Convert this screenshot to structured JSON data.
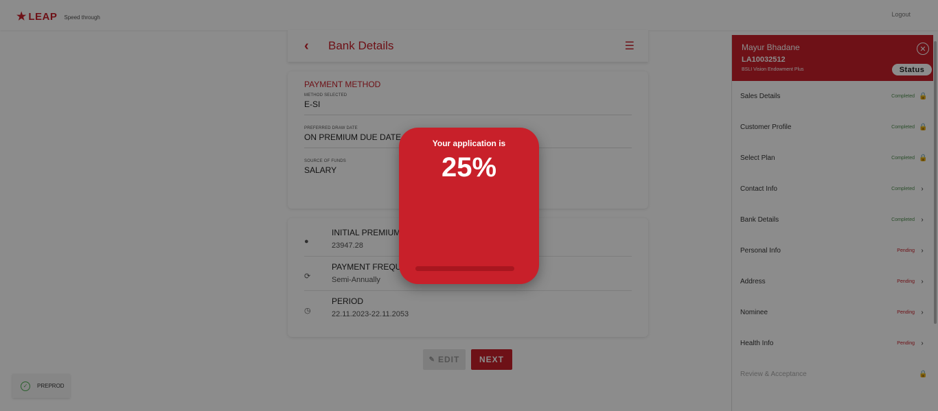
{
  "header": {
    "logo_text": "LEAP",
    "tagline": "Speed through",
    "logout": "Logout"
  },
  "page": {
    "title": "Bank Details"
  },
  "payment": {
    "section_title": "PAYMENT METHOD",
    "fields": [
      {
        "label": "METHOD SELECTED",
        "value": "E-SI"
      },
      {
        "label": "PREFERRED DRAW DATE",
        "value": "ON PREMIUM DUE DATE"
      },
      {
        "label": "SOURCE OF FUNDS",
        "value": "SALARY"
      }
    ]
  },
  "premium": {
    "rows": [
      {
        "title": "INITIAL PREMIUM",
        "value": "23947.28",
        "icon": "coin-icon"
      },
      {
        "title": "PAYMENT FREQUENCY",
        "value": "Semi-Annually",
        "icon": "refresh-icon"
      },
      {
        "title": "PERIOD",
        "value": "22.11.2023-22.11.2053",
        "icon": "clock-icon"
      }
    ]
  },
  "buttons": {
    "edit": "EDIT",
    "next": "NEXT"
  },
  "sidebar": {
    "name": "Mayur Bhadane",
    "application_id": "LA10032512",
    "plan": "BSLI Vision Endowment Plus",
    "status_label": "Status",
    "steps": [
      {
        "label": "Sales Details",
        "status": "Completed",
        "icon": "lock-icon"
      },
      {
        "label": "Customer Profile",
        "status": "Completed",
        "icon": "lock-icon"
      },
      {
        "label": "Select Plan",
        "status": "Completed",
        "icon": "lock-icon"
      },
      {
        "label": "Contact Info",
        "status": "Completed",
        "icon": "chevron-right-icon"
      },
      {
        "label": "Bank Details",
        "status": "Completed",
        "icon": "chevron-right-icon"
      },
      {
        "label": "Personal Info",
        "status": "Pending",
        "icon": "chevron-right-icon"
      },
      {
        "label": "Address",
        "status": "Pending",
        "icon": "chevron-right-icon"
      },
      {
        "label": "Nominee",
        "status": "Pending",
        "icon": "chevron-right-icon"
      },
      {
        "label": "Health Info",
        "status": "Pending",
        "icon": "chevron-right-icon"
      },
      {
        "label": "Review & Acceptance",
        "status": "",
        "icon": "lock-icon"
      }
    ]
  },
  "env_badge": "PREPROD",
  "modal": {
    "message": "Your application is",
    "percent_text": "25%",
    "progress": 0.25
  },
  "colors": {
    "brand": "#c8202a",
    "completed": "#4f8f4f"
  }
}
